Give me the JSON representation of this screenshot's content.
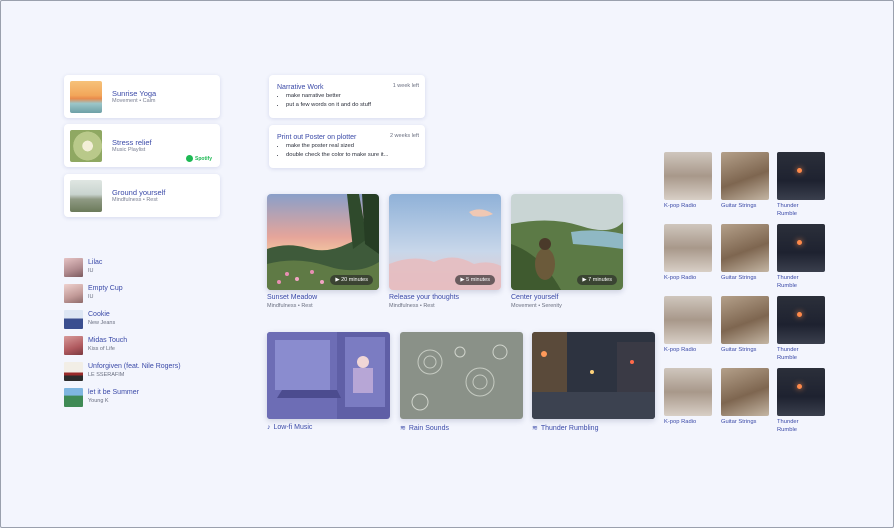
{
  "playlists": [
    {
      "title": "Sunrise Yoga",
      "subtitle": "Movement • Calm"
    },
    {
      "title": "Stress relief",
      "subtitle": "Music Playlist",
      "badge": "Spotify"
    },
    {
      "title": "Ground yourself",
      "subtitle": "Mindfulness • Rest"
    }
  ],
  "tasks": [
    {
      "title": "Narrative Work",
      "due": "1 week left",
      "items": [
        "make narrative better",
        "put a few words on it and do stuff"
      ]
    },
    {
      "title": "Print out Poster on plotter",
      "due": "2 weeks left",
      "items": [
        "make the poster real sized",
        "double check the color to make sure it..."
      ]
    }
  ],
  "songs": [
    {
      "title": "Lilac",
      "artist": "IU"
    },
    {
      "title": "Empty Cup",
      "artist": "IU"
    },
    {
      "title": "Cookie",
      "artist": "New Jeans"
    },
    {
      "title": "Midas Touch",
      "artist": "Kiss of Life"
    },
    {
      "title": "Unforgiven (feat. Nile Rogers)",
      "artist": "LE SSERAFIM"
    },
    {
      "title": "let it be Summer",
      "artist": "Young K"
    }
  ],
  "sessions": [
    {
      "title": "Sunset Meadow",
      "subtitle": "Mindfulness • Rest",
      "duration": "▶ 20 minutes"
    },
    {
      "title": "Release your thoughts",
      "subtitle": "Mindfulness • Rest",
      "duration": "▶ 5 minutes"
    },
    {
      "title": "Center yourself",
      "subtitle": "Movement • Serenity",
      "duration": "▶ 7 minutes"
    }
  ],
  "mixes": [
    {
      "title": "Low-fi Music",
      "icon": "music-note-icon"
    },
    {
      "title": "Rain Sounds",
      "icon": "sound-wave-icon"
    },
    {
      "title": "Thunder Rumbling",
      "icon": "sound-wave-icon"
    }
  ],
  "radio_grid": {
    "labels": [
      "K-pop Radio",
      "Guitar Strings",
      "Thunder Rumble"
    ]
  }
}
